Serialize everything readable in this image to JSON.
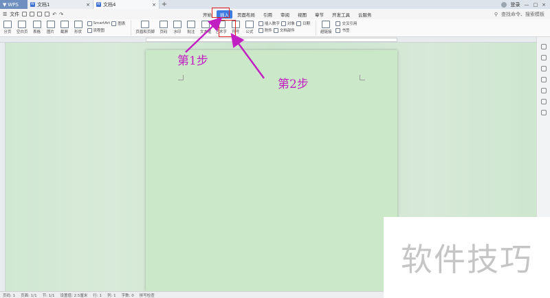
{
  "tabs": {
    "home": "WPS",
    "doc1": "文档1",
    "doc2": "文档4",
    "add": "+"
  },
  "titlebar": {
    "user": "登录"
  },
  "menu": {
    "file": "文件"
  },
  "ribbon_tabs": [
    {
      "label": "开始"
    },
    {
      "label": "插入"
    },
    {
      "label": "页面布局"
    },
    {
      "label": "引用"
    },
    {
      "label": "审阅"
    },
    {
      "label": "视图"
    },
    {
      "label": "章节"
    },
    {
      "label": "开发工具"
    },
    {
      "label": "云服务"
    }
  ],
  "search_placeholder": "查找命令、搜索模板",
  "toolbar": {
    "page": "分页",
    "blank_page": "空白页",
    "table": "表格",
    "picture": "图片",
    "screenshot": "截屏",
    "shape": "形状",
    "smartart": "SmartArt",
    "chart": "图表",
    "flowchart": "流程图",
    "header_footer": "页眉和页脚",
    "page_number": "页码",
    "watermark": "水印",
    "comment": "批注",
    "textbox": "文本框",
    "wordart": "艺术字",
    "symbol": "符号",
    "formula": "公式",
    "insert_number": "插入数字",
    "object": "对象",
    "date": "日期",
    "attachment": "附件",
    "hyperlink": "超链接",
    "bookmark": "书签",
    "cross_ref": "交叉引用",
    "doc_parts": "文档部件"
  },
  "annotations": {
    "step1": "第1步",
    "step2": "第2步"
  },
  "status": {
    "page": "页码: 1",
    "pages": "页面: 1/1",
    "section": "节: 1/1",
    "position": "设置值: 2.5厘米",
    "row": "行: 1",
    "col": "列: 1",
    "words": "字数: 0",
    "spell": "拼写检查"
  },
  "watermark_text": "软件技巧",
  "colors": {
    "accent": "#3d7be0",
    "highlight": "#e02020",
    "annotation": "#c21fc2",
    "page": "#cbe8c9"
  }
}
